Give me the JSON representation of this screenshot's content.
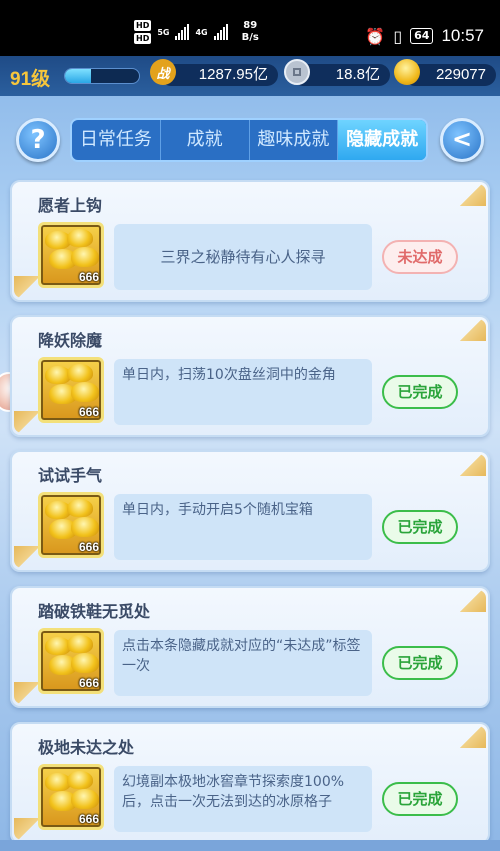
{
  "statusbar": {
    "hd1": "HD",
    "hd2": "HD",
    "sig1_label": "5G",
    "sig2_label": "4G",
    "net_speed": "89",
    "net_unit": "B/s",
    "battery": "64",
    "time": "10:57"
  },
  "topbar": {
    "level": "91级",
    "exp_fraction": 0.35,
    "combat_power": "1287.95亿",
    "silver": "18.8亿",
    "gold": "229077",
    "combat_icon": "战"
  },
  "tabs": [
    {
      "label": "日常任务",
      "active": false
    },
    {
      "label": "成就",
      "active": false
    },
    {
      "label": "趣味成就",
      "active": false
    },
    {
      "label": "隐藏成就",
      "active": true
    }
  ],
  "help_label": "?",
  "back_icon": "back-arrow-icon",
  "achievements": [
    {
      "title": "愿者上钩",
      "reward_qty": "666",
      "description": "三界之秘静待有心人探寻",
      "status": "未达成",
      "completed": false
    },
    {
      "title": "降妖除魔",
      "reward_qty": "666",
      "description": "单日内，扫荡10次盘丝洞中的金角",
      "status": "已完成",
      "completed": true
    },
    {
      "title": "试试手气",
      "reward_qty": "666",
      "description": "单日内，手动开启5个随机宝箱",
      "status": "已完成",
      "completed": true
    },
    {
      "title": "踏破铁鞋无觅处",
      "reward_qty": "666",
      "description": "点击本条隐藏成就对应的“未达成”标签一次",
      "status": "已完成",
      "completed": true
    },
    {
      "title": "极地未达之处",
      "reward_qty": "666",
      "description": "幻境副本极地冰窖章节探索度100%后，点击一次无法到达的冰原格子",
      "status": "已完成",
      "completed": true
    }
  ],
  "colors": {
    "completed": "#2aa43a",
    "not_completed": "#e06a6a",
    "tab_active": "#2fa8f0",
    "level_gold": "#f6c63c"
  }
}
